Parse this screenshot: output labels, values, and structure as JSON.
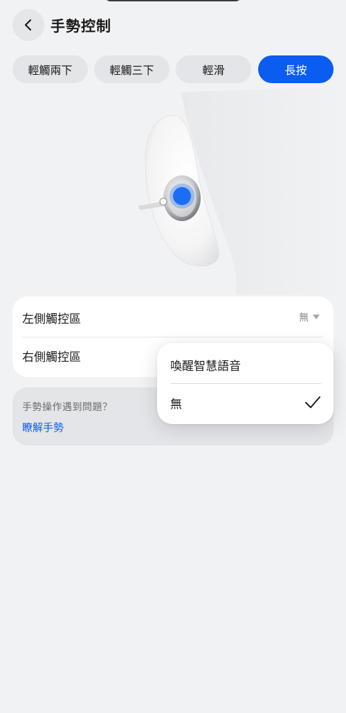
{
  "header": {
    "title": "手勢控制",
    "back_icon": "chevron-left-icon"
  },
  "tabs": [
    {
      "label": "輕觸兩下",
      "active": false
    },
    {
      "label": "輕觸三下",
      "active": false
    },
    {
      "label": "輕滑",
      "active": false
    },
    {
      "label": "長按",
      "active": true
    }
  ],
  "touch_areas": {
    "left": {
      "label": "左側觸控區",
      "value": "無",
      "icon": "caret-down-icon"
    },
    "right": {
      "label": "右側觸控區"
    }
  },
  "help": {
    "question": "手勢操作遇到問題？",
    "link": "瞭解手勢"
  },
  "dropdown": {
    "options": [
      {
        "label": "喚醒智慧語音",
        "selected": false
      },
      {
        "label": "無",
        "selected": true
      }
    ],
    "selected_icon": "checkmark-icon"
  },
  "colors": {
    "accent": "#0b5cf0",
    "background": "#f1f2f4",
    "card": "#ffffff"
  }
}
